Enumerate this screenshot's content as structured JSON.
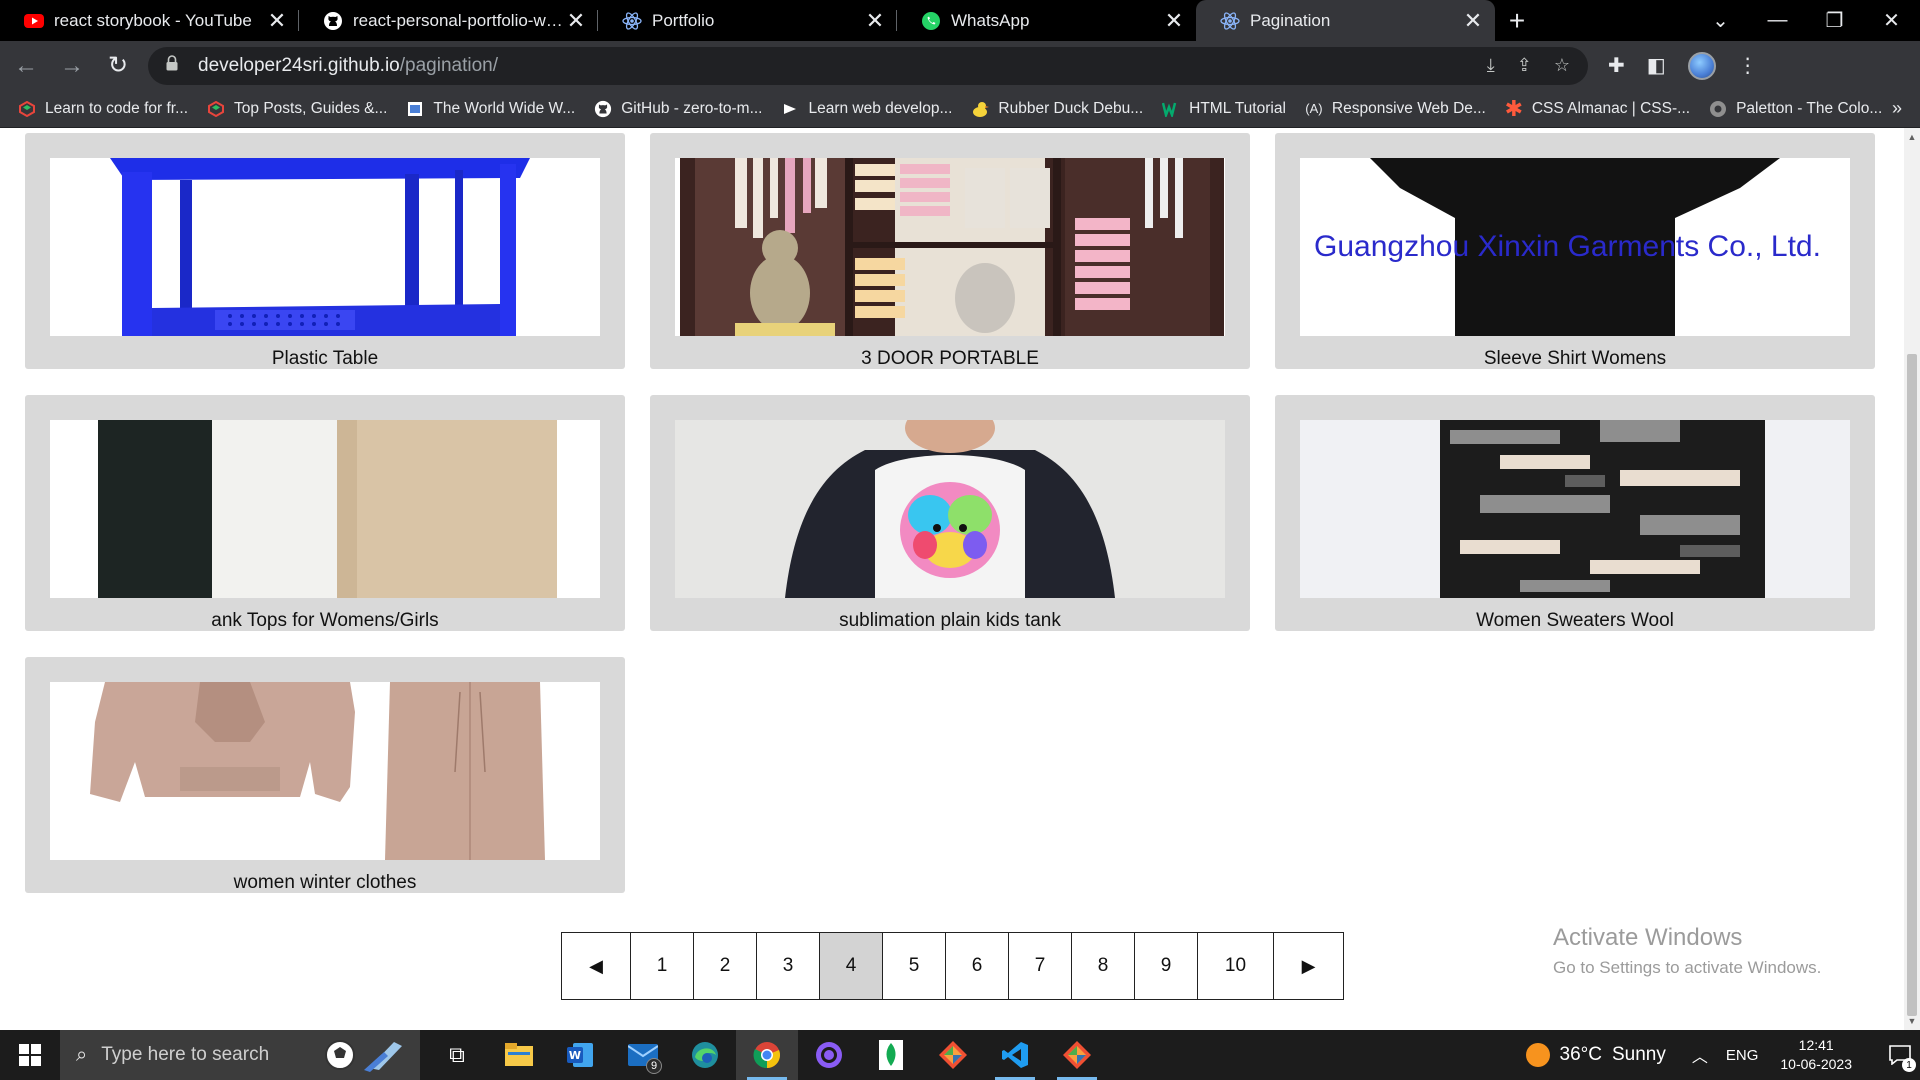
{
  "browser": {
    "tabs": [
      {
        "title": "react storybook - YouTube",
        "icon": "youtube-icon",
        "active": false
      },
      {
        "title": "react-personal-portfolio-website",
        "icon": "github-icon",
        "active": false
      },
      {
        "title": "Portfolio",
        "icon": "react-icon",
        "active": false
      },
      {
        "title": "WhatsApp",
        "icon": "whatsapp-icon",
        "active": false
      },
      {
        "title": "Pagination",
        "icon": "react-icon",
        "active": true
      }
    ],
    "new_tab_glyph": "+",
    "close_glyph": "✕",
    "url_host": "developer24sri.github.io",
    "url_path": "/pagination/",
    "bookmarks": [
      {
        "label": "Learn to code for fr...",
        "icon": "freecodecamp-icon"
      },
      {
        "label": "Top Posts, Guides &...",
        "icon": "devdojo-icon"
      },
      {
        "label": "The World Wide W...",
        "icon": "www-icon"
      },
      {
        "label": "GitHub - zero-to-m...",
        "icon": "github-icon"
      },
      {
        "label": "Learn web develop...",
        "icon": "mdn-icon"
      },
      {
        "label": "Rubber Duck Debu...",
        "icon": "duck-icon"
      },
      {
        "label": "HTML Tutorial",
        "icon": "w3schools-icon"
      },
      {
        "label": "Responsive Web De...",
        "icon": "a11y-icon"
      },
      {
        "label": "CSS Almanac | CSS-...",
        "icon": "css-tricks-icon"
      },
      {
        "label": "Paletton - The Colo...",
        "icon": "paletton-icon"
      }
    ]
  },
  "products": [
    {
      "title": "Plastic Table"
    },
    {
      "title": "3 DOOR PORTABLE"
    },
    {
      "title": "Sleeve Shirt Womens",
      "overlay": "Guangzhou Xinxin Garments Co., Ltd."
    },
    {
      "title": "ank Tops for Womens/Girls"
    },
    {
      "title": "sublimation plain kids tank"
    },
    {
      "title": "Women Sweaters Wool"
    },
    {
      "title": "women winter clothes"
    }
  ],
  "pagination": {
    "prev": "◀",
    "next": "▶",
    "pages": [
      "1",
      "2",
      "3",
      "4",
      "5",
      "6",
      "7",
      "8",
      "9",
      "10"
    ],
    "current": "4"
  },
  "watermark": {
    "line1": "Activate Windows",
    "line2": "Go to Settings to activate Windows."
  },
  "taskbar": {
    "search_placeholder": "Type here to search",
    "mail_badge": "9",
    "weather_temp": "36°C",
    "weather_text": "Sunny",
    "language": "ENG",
    "time": "12:41",
    "date": "10-06-2023",
    "notification_count": "1"
  },
  "colors": {
    "card_bg": "#d9d9d9",
    "current_page_bg": "#d3d3d3",
    "taskbar_bg": "#1c1c1c",
    "chrome_bg": "#35363a"
  }
}
